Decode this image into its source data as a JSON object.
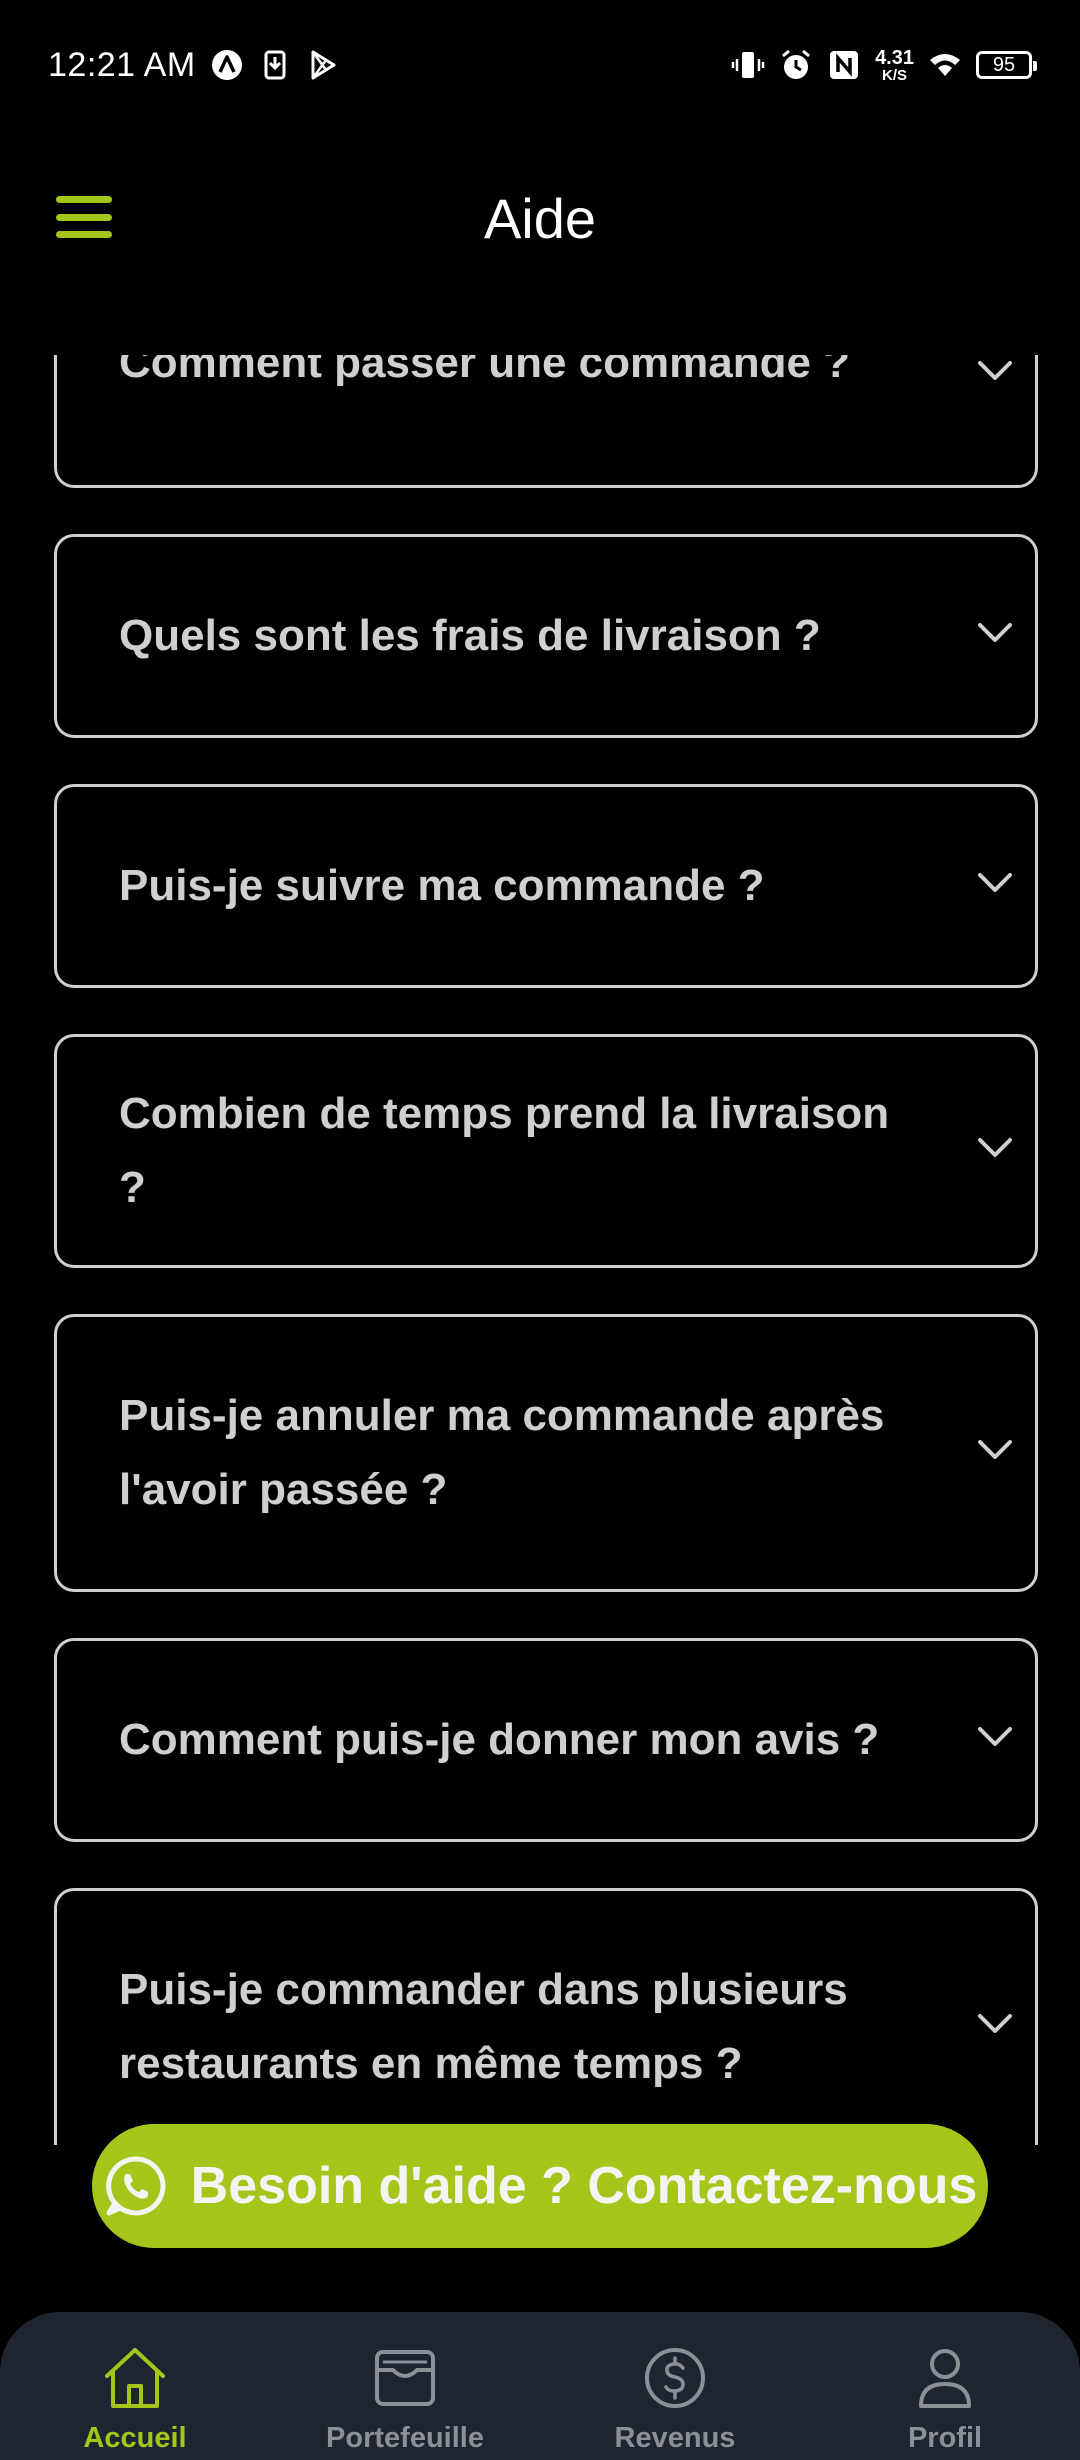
{
  "status_bar": {
    "time": "12:21 AM",
    "net_speed_value": "4.31",
    "net_speed_unit": "K/S",
    "battery": "95",
    "left_icons": [
      "app-a-icon",
      "download-icon",
      "play-store-icon"
    ],
    "right_icons": [
      "vibrate-icon",
      "alarm-icon",
      "nfc-icon",
      "wifi-icon"
    ]
  },
  "header": {
    "title": "Aide",
    "menu_icon": "hamburger-menu-icon",
    "accent_color": "#a4c61a"
  },
  "faq": {
    "items": [
      {
        "question": "Comment passer une commande ?"
      },
      {
        "question": "Quels sont les frais de livraison ?"
      },
      {
        "question": "Puis-je suivre ma commande ?"
      },
      {
        "question": "Combien de temps prend la livraison ?"
      },
      {
        "question": "Puis-je annuler ma commande après l'avoir passée ?"
      },
      {
        "question": "Comment puis-je donner mon avis ?"
      },
      {
        "question": "Puis-je commander dans plusieurs restaurants en même temps ?"
      }
    ],
    "expand_icon": "chevron-down-icon"
  },
  "contact": {
    "label": "Besoin d'aide ? Contactez-nous",
    "icon": "whatsapp-icon",
    "color": "#a4c61a"
  },
  "bottom_nav": {
    "items": [
      {
        "label": "Accueil",
        "icon": "home-icon",
        "active": true
      },
      {
        "label": "Portefeuille",
        "icon": "wallet-icon",
        "active": false
      },
      {
        "label": "Revenus",
        "icon": "dollar-icon",
        "active": false
      },
      {
        "label": "Profil",
        "icon": "profile-icon",
        "active": false
      }
    ],
    "background": "#1f2530",
    "inactive_color": "#8b8f96"
  }
}
